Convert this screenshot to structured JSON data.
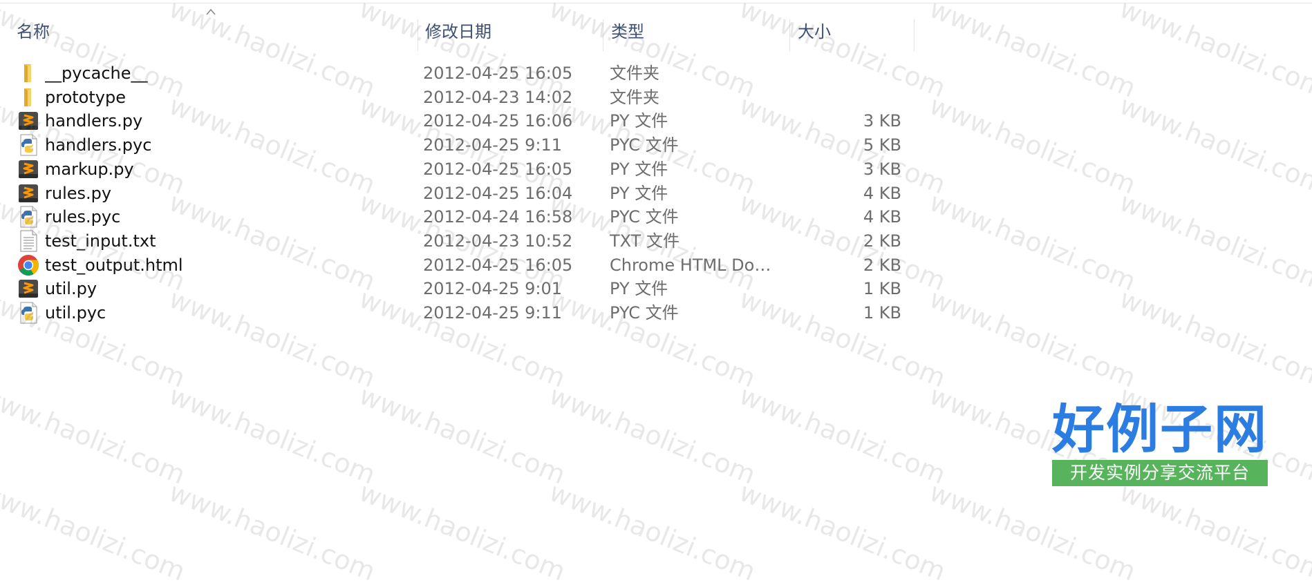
{
  "header": {
    "sort_arrow_icon": "chevron-up-icon",
    "columns": [
      {
        "label": "名称"
      },
      {
        "label": "修改日期"
      },
      {
        "label": "类型"
      },
      {
        "label": "大小"
      }
    ]
  },
  "files": [
    {
      "name": "__pycache__",
      "date": "2012-04-25 16:05",
      "type": "文件夹",
      "size": "",
      "icon": "folder-icon"
    },
    {
      "name": "prototype",
      "date": "2012-04-23 14:02",
      "type": "文件夹",
      "size": "",
      "icon": "folder-icon"
    },
    {
      "name": "handlers.py",
      "date": "2012-04-25 16:06",
      "type": "PY 文件",
      "size": "3 KB",
      "icon": "sublime-file-icon"
    },
    {
      "name": "handlers.pyc",
      "date": "2012-04-25 9:11",
      "type": "PYC 文件",
      "size": "5 KB",
      "icon": "python-compiled-file-icon"
    },
    {
      "name": "markup.py",
      "date": "2012-04-25 16:05",
      "type": "PY 文件",
      "size": "3 KB",
      "icon": "sublime-file-icon"
    },
    {
      "name": "rules.py",
      "date": "2012-04-25 16:04",
      "type": "PY 文件",
      "size": "4 KB",
      "icon": "sublime-file-icon"
    },
    {
      "name": "rules.pyc",
      "date": "2012-04-24 16:58",
      "type": "PYC 文件",
      "size": "4 KB",
      "icon": "python-compiled-file-icon"
    },
    {
      "name": "test_input.txt",
      "date": "2012-04-23 10:52",
      "type": "TXT 文件",
      "size": "2 KB",
      "icon": "text-file-icon"
    },
    {
      "name": "test_output.html",
      "date": "2012-04-25 16:05",
      "type": "Chrome HTML Doc...",
      "size": "2 KB",
      "icon": "chrome-icon"
    },
    {
      "name": "util.py",
      "date": "2012-04-25 9:01",
      "type": "PY 文件",
      "size": "1 KB",
      "icon": "sublime-file-icon"
    },
    {
      "name": "util.pyc",
      "date": "2012-04-25 9:11",
      "type": "PYC 文件",
      "size": "1 KB",
      "icon": "python-compiled-file-icon"
    }
  ],
  "watermark": {
    "text": "www.haolizi.com"
  },
  "logo": {
    "title": "好例子网",
    "subtitle": "开发实例分享交流平台"
  },
  "colors": {
    "header_text": "#3d4f74",
    "name_text": "#111111",
    "detail_text": "#6d6d6d",
    "folder_yellow": "#f3c44a",
    "logo_blue": "#2b7de1",
    "logo_green": "#58b45c"
  }
}
